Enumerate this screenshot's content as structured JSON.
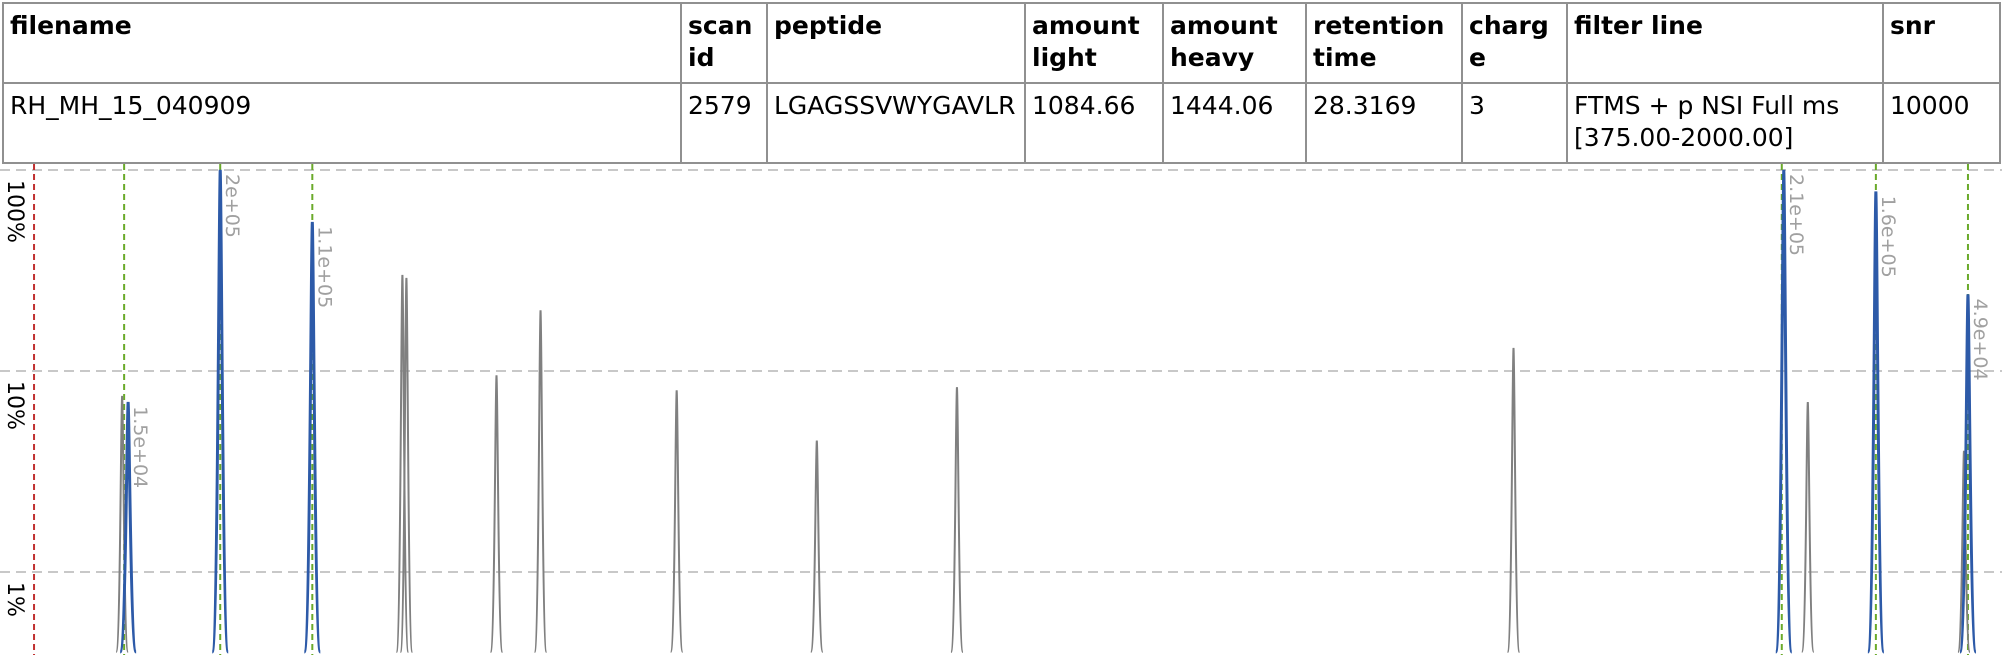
{
  "table": {
    "headers": {
      "filename": "filename",
      "scan_id": "scan id",
      "peptide": "peptide",
      "amount_light": "amount light",
      "amount_heavy": "amount heavy",
      "retention_time": "retention time",
      "charge": "charge",
      "filter_line": "filter line",
      "snr": "snr"
    },
    "row": {
      "filename": "RH_MH_15_040909",
      "scan_id": "2579",
      "peptide": "LGAGSSVWYGAVLR",
      "amount_light": "1084.66",
      "amount_heavy": "1444.06",
      "retention_time": "28.3169",
      "charge": "3",
      "filter_line": "FTMS + p NSI Full ms [375.00-2000.00]",
      "snr": "10000"
    }
  },
  "chart_data": {
    "type": "line",
    "title": "",
    "xlabel": "",
    "ylabel": "",
    "y_scale": "log",
    "y_ticks": [
      {
        "value": 100,
        "label": "100%"
      },
      {
        "value": 10,
        "label": "10%"
      },
      {
        "value": 1,
        "label": "1%"
      }
    ],
    "ylim": [
      0.4,
      100
    ],
    "xlim": [
      0,
      1000
    ],
    "grid": true,
    "colors": {
      "background_peaks": "#808080",
      "matched_peaks": "#2d5aa8",
      "expected_markers": "#6aaa2a",
      "reference_marker": "#c03030",
      "peak_labels": "#a0a0a0",
      "grid": "#c8c8c8"
    },
    "reference_marker": {
      "x": 17
    },
    "expected_markers": [
      62,
      110,
      156,
      890,
      937,
      983
    ],
    "background_peaks": [
      {
        "x": 61,
        "y": 7.5
      },
      {
        "x": 201,
        "y": 30
      },
      {
        "x": 203,
        "y": 29
      },
      {
        "x": 248,
        "y": 9.5
      },
      {
        "x": 270,
        "y": 20
      },
      {
        "x": 338,
        "y": 8.0
      },
      {
        "x": 408,
        "y": 4.5
      },
      {
        "x": 478,
        "y": 8.3
      },
      {
        "x": 756,
        "y": 13
      },
      {
        "x": 903,
        "y": 7.0
      },
      {
        "x": 981,
        "y": 4.0
      }
    ],
    "matched_peaks": [
      {
        "x": 64,
        "y": 7.0,
        "label": "1.5e+04"
      },
      {
        "x": 110,
        "y": 100,
        "label": "2e+05"
      },
      {
        "x": 156,
        "y": 55,
        "label": "1.1e+05"
      },
      {
        "x": 891,
        "y": 100,
        "label": "2.1e+05"
      },
      {
        "x": 937,
        "y": 78,
        "label": "1.6e+05"
      },
      {
        "x": 983,
        "y": 24,
        "label": "4.9e+04"
      }
    ]
  }
}
